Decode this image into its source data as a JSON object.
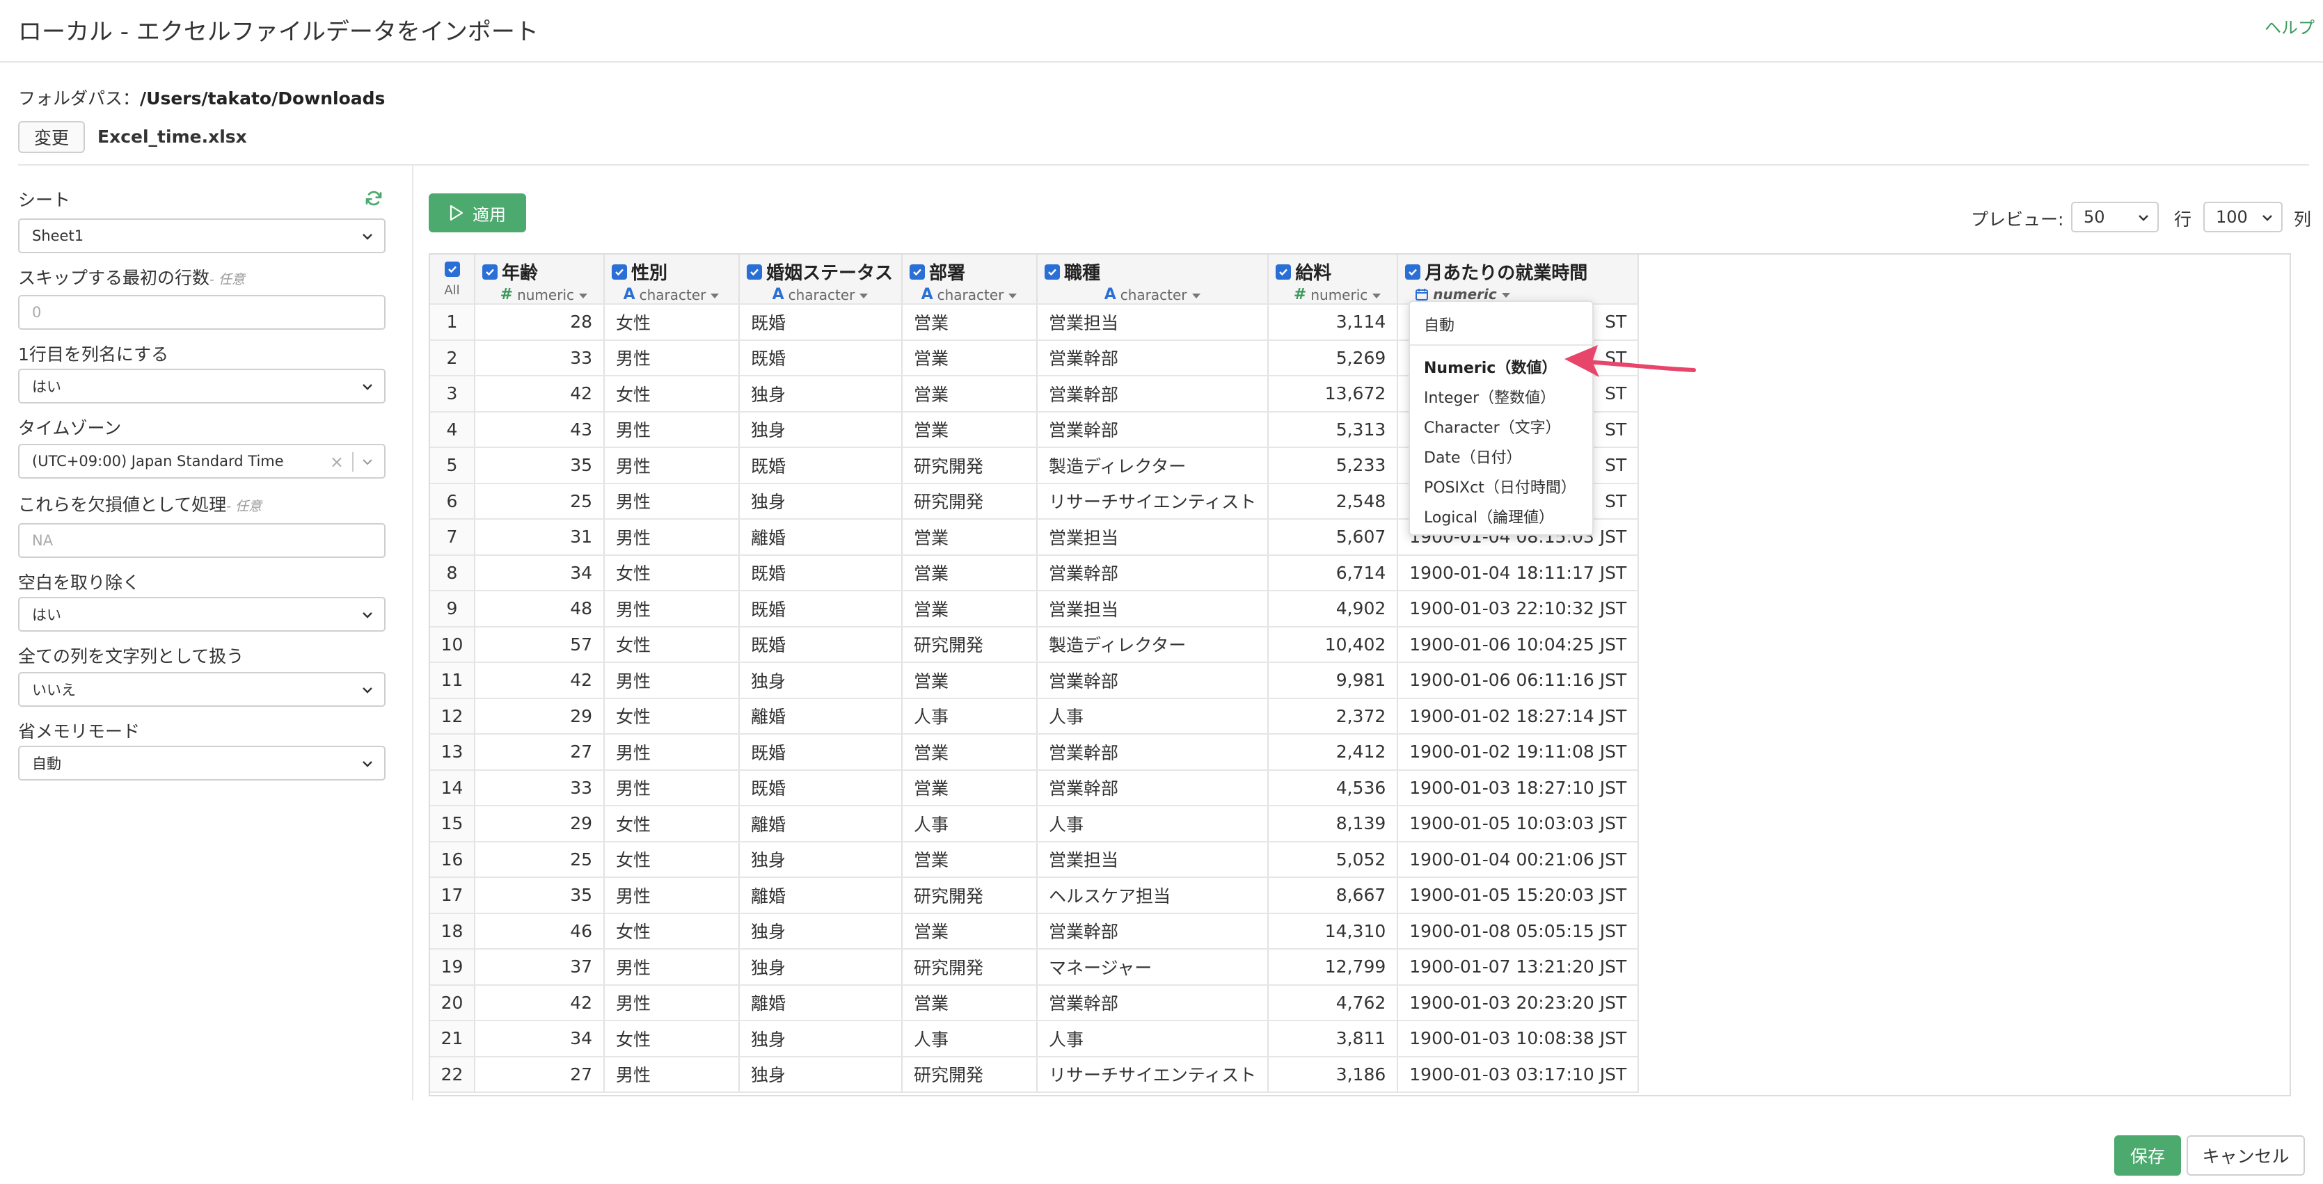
{
  "header": {
    "title": "ローカル - エクセルファイルデータをインポート",
    "help": "ヘルプ"
  },
  "file": {
    "folder_label": "フォルダパス：",
    "folder_path": "/Users/takato/Downloads",
    "change_label": "変更",
    "file_name": "Excel_time.xlsx"
  },
  "sidebar": {
    "sheet": {
      "label": "シート",
      "value": "Sheet1"
    },
    "skip_rows": {
      "label": "スキップする最初の行数",
      "optional": "- 任意",
      "placeholder": "0"
    },
    "first_row_header": {
      "label": "1行目を列名にする",
      "value": "はい"
    },
    "timezone": {
      "label": "タイムゾーン",
      "value": "(UTC+09:00) Japan Standard Time",
      "clear": "×"
    },
    "na_values": {
      "label": "これらを欠損値として処理",
      "optional": "- 任意",
      "placeholder": "NA"
    },
    "trim_ws": {
      "label": "空白を取り除く",
      "value": "はい"
    },
    "all_as_char": {
      "label": "全ての列を文字列として扱う",
      "value": "いいえ"
    },
    "memory_saving": {
      "label": "省メモリモード",
      "value": "自動"
    }
  },
  "toolbar": {
    "apply_label": "適用",
    "preview_label": "プレビュー:",
    "preview_rows": "50",
    "row_label": "行",
    "preview_cols": "100",
    "col_label": "列"
  },
  "table": {
    "all_label": "All",
    "columns": [
      {
        "name": "年齢",
        "type": "numeric",
        "type_icon": "hash-icon"
      },
      {
        "name": "性別",
        "type": "character",
        "type_icon": "letter-a-icon"
      },
      {
        "name": "婚姻ステータス",
        "type": "character",
        "type_icon": "letter-a-icon"
      },
      {
        "name": "部署",
        "type": "character",
        "type_icon": "letter-a-icon"
      },
      {
        "name": "職種",
        "type": "character",
        "type_icon": "letter-a-icon"
      },
      {
        "name": "給料",
        "type": "numeric",
        "type_icon": "hash-icon"
      },
      {
        "name": "月あたりの就業時間",
        "type": "numeric",
        "type_icon": "calendar-icon"
      }
    ],
    "rows": [
      [
        "1",
        "28",
        "女性",
        "既婚",
        "営業",
        "営業担当",
        "3,114",
        ""
      ],
      [
        "2",
        "33",
        "男性",
        "既婚",
        "営業",
        "営業幹部",
        "5,269",
        ""
      ],
      [
        "3",
        "42",
        "女性",
        "独身",
        "営業",
        "営業幹部",
        "13,672",
        ""
      ],
      [
        "4",
        "43",
        "男性",
        "独身",
        "営業",
        "営業幹部",
        "5,313",
        ""
      ],
      [
        "5",
        "35",
        "男性",
        "既婚",
        "研究開発",
        "製造ディレクター",
        "5,233",
        ""
      ],
      [
        "6",
        "25",
        "男性",
        "独身",
        "研究開発",
        "リサーチサイエンティスト",
        "2,548",
        ""
      ],
      [
        "7",
        "31",
        "男性",
        "離婚",
        "営業",
        "営業担当",
        "5,607",
        ""
      ],
      [
        "8",
        "34",
        "女性",
        "既婚",
        "営業",
        "営業幹部",
        "6,714",
        "1900-01-04 18:11:17 JST"
      ],
      [
        "9",
        "48",
        "男性",
        "既婚",
        "営業",
        "営業担当",
        "4,902",
        "1900-01-03 22:10:32 JST"
      ],
      [
        "10",
        "57",
        "女性",
        "既婚",
        "研究開発",
        "製造ディレクター",
        "10,402",
        "1900-01-06 10:04:25 JST"
      ],
      [
        "11",
        "42",
        "男性",
        "独身",
        "営業",
        "営業幹部",
        "9,981",
        "1900-01-06 06:11:16 JST"
      ],
      [
        "12",
        "29",
        "女性",
        "離婚",
        "人事",
        "人事",
        "2,372",
        "1900-01-02 18:27:14 JST"
      ],
      [
        "13",
        "27",
        "男性",
        "既婚",
        "営業",
        "営業幹部",
        "2,412",
        "1900-01-02 19:11:08 JST"
      ],
      [
        "14",
        "33",
        "男性",
        "既婚",
        "営業",
        "営業幹部",
        "4,536",
        "1900-01-03 18:27:10 JST"
      ],
      [
        "15",
        "29",
        "女性",
        "離婚",
        "人事",
        "人事",
        "8,139",
        "1900-01-05 10:03:03 JST"
      ],
      [
        "16",
        "25",
        "女性",
        "独身",
        "営業",
        "営業担当",
        "5,052",
        "1900-01-04 00:21:06 JST"
      ],
      [
        "17",
        "35",
        "男性",
        "離婚",
        "研究開発",
        "ヘルスケア担当",
        "8,667",
        "1900-01-05 15:20:03 JST"
      ],
      [
        "18",
        "46",
        "女性",
        "独身",
        "営業",
        "営業幹部",
        "14,310",
        "1900-01-08 05:05:15 JST"
      ],
      [
        "19",
        "37",
        "男性",
        "独身",
        "研究開発",
        "マネージャー",
        "12,799",
        "1900-01-07 13:21:20 JST"
      ],
      [
        "20",
        "42",
        "男性",
        "離婚",
        "営業",
        "営業幹部",
        "4,762",
        "1900-01-03 20:23:20 JST"
      ],
      [
        "21",
        "34",
        "女性",
        "独身",
        "人事",
        "人事",
        "3,811",
        "1900-01-03 10:08:38 JST"
      ],
      [
        "22",
        "27",
        "男性",
        "独身",
        "研究開発",
        "リサーチサイエンティスト",
        "3,186",
        "1900-01-03 03:17:10 JST"
      ]
    ],
    "partial_col7": [
      "ST",
      "ST",
      "ST",
      "ST",
      "ST",
      "ST",
      "1900-01-04 08:15:03 JST"
    ]
  },
  "type_menu": {
    "auto": "自動",
    "items": [
      "Numeric（数値）",
      "Integer（整数値）",
      "Character（文字）",
      "Date（日付）",
      "POSIXct（日付時間）",
      "Logical（論理値）"
    ]
  },
  "footer": {
    "save_label": "保存",
    "cancel_label": "キャンセル"
  },
  "colors": {
    "accent_green": "#4caa6e",
    "checkbox_blue": "#2a6fd6",
    "arrow_pink": "#e8456b"
  }
}
